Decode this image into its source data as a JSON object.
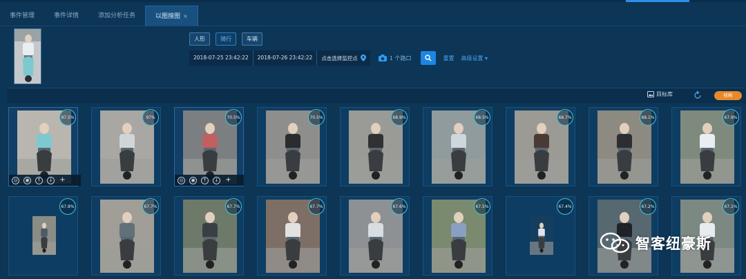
{
  "tabs": [
    {
      "label": "事件管理",
      "active": false
    },
    {
      "label": "事件详情",
      "active": false
    },
    {
      "label": "添加分析任务",
      "active": false
    },
    {
      "label": "以图搜图",
      "active": true
    }
  ],
  "search": {
    "types": [
      "人形",
      "骑行",
      "车辆"
    ],
    "selected_type": "骑行",
    "start_time": "2018-07-25 23:42:22",
    "end_time": "2018-07-26 23:42:22",
    "region_placeholder": "点击选择监控点",
    "camera_count": "1 个路口",
    "reset_label": "重置",
    "advanced_label": "高级设置"
  },
  "results_toolbar": {
    "target_library_label": "目标库",
    "action_button_label": "结构"
  },
  "results": [
    {
      "score": "97.5%"
    },
    {
      "score": "97%"
    },
    {
      "score": "70.5%"
    },
    {
      "score": "70.5%"
    },
    {
      "score": "68.9%"
    },
    {
      "score": "68.5%"
    },
    {
      "score": "68.7%"
    },
    {
      "score": "68.1%"
    },
    {
      "score": "67.9%"
    },
    {
      "score": "67.8%"
    },
    {
      "score": "67.7%"
    },
    {
      "score": "67.7%"
    },
    {
      "score": "67.7%"
    },
    {
      "score": "67.6%"
    },
    {
      "score": "67.5%"
    },
    {
      "score": "67.4%"
    },
    {
      "score": "67.2%"
    },
    {
      "score": "67.1%"
    }
  ],
  "watermark": "智客纽豪斯",
  "colors": {
    "background": "#0c3556",
    "accent": "#1d86e3",
    "score_ring": "#47c3d6",
    "orange": "#e88a2a"
  }
}
